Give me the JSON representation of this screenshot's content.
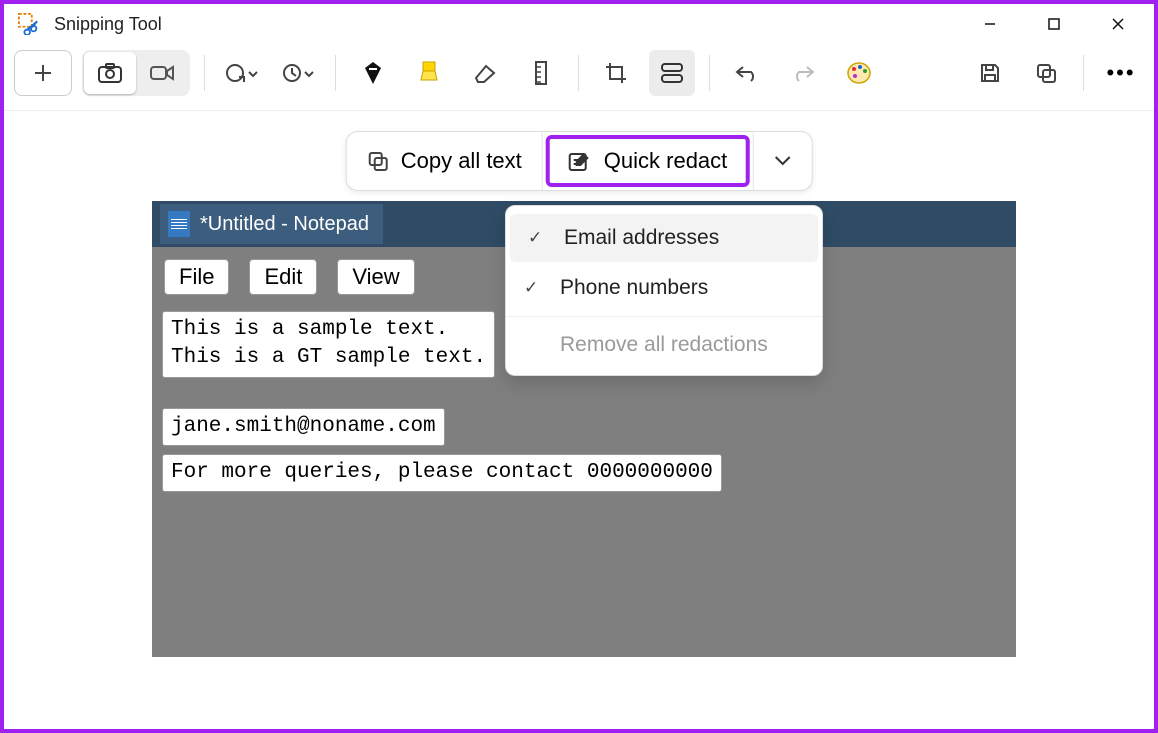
{
  "app_title": "Snipping Tool",
  "window_controls": {
    "min": "—",
    "max": "□",
    "close": "✕"
  },
  "toolbar": {
    "new": "+",
    "modes": {
      "camera": "camera",
      "video": "video"
    },
    "more": "• • •"
  },
  "pill": {
    "copy": "Copy all text",
    "quick_redact": "Quick redact"
  },
  "dropdown": {
    "email": "Email addresses",
    "phone": "Phone numbers",
    "remove": "Remove all redactions",
    "email_checked": true,
    "phone_checked": true
  },
  "notepad": {
    "tab_title": "*Untitled - Notepad",
    "menus": [
      "File",
      "Edit",
      "View"
    ],
    "chunk1": "This is a sample text.\nThis is a GT sample text.",
    "chunk2": "jane.smith@noname.com",
    "chunk3": "For more queries, please contact 0000000000"
  }
}
